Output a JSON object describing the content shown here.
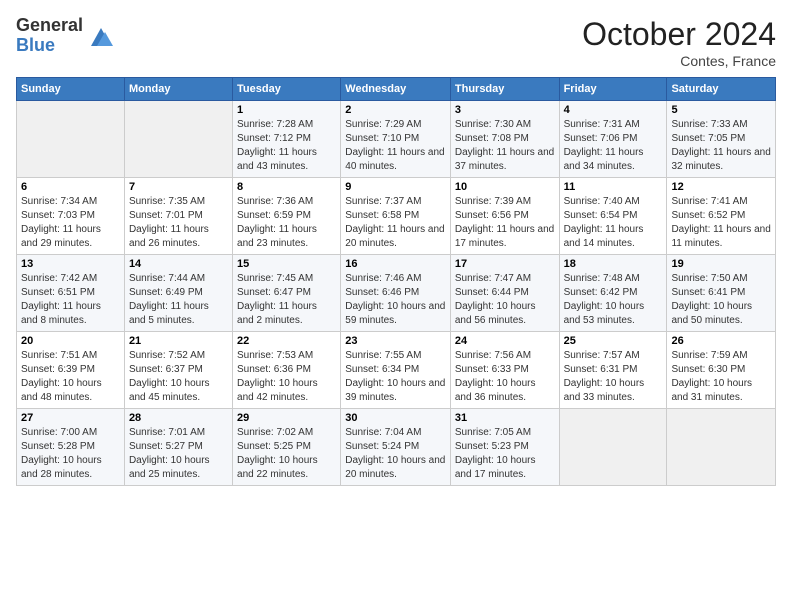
{
  "logo": {
    "general": "General",
    "blue": "Blue"
  },
  "title": "October 2024",
  "location": "Contes, France",
  "days_of_week": [
    "Sunday",
    "Monday",
    "Tuesday",
    "Wednesday",
    "Thursday",
    "Friday",
    "Saturday"
  ],
  "weeks": [
    [
      {
        "day": "",
        "info": ""
      },
      {
        "day": "",
        "info": ""
      },
      {
        "day": "1",
        "info": "Sunrise: 7:28 AM\nSunset: 7:12 PM\nDaylight: 11 hours and 43 minutes."
      },
      {
        "day": "2",
        "info": "Sunrise: 7:29 AM\nSunset: 7:10 PM\nDaylight: 11 hours and 40 minutes."
      },
      {
        "day": "3",
        "info": "Sunrise: 7:30 AM\nSunset: 7:08 PM\nDaylight: 11 hours and 37 minutes."
      },
      {
        "day": "4",
        "info": "Sunrise: 7:31 AM\nSunset: 7:06 PM\nDaylight: 11 hours and 34 minutes."
      },
      {
        "day": "5",
        "info": "Sunrise: 7:33 AM\nSunset: 7:05 PM\nDaylight: 11 hours and 32 minutes."
      }
    ],
    [
      {
        "day": "6",
        "info": "Sunrise: 7:34 AM\nSunset: 7:03 PM\nDaylight: 11 hours and 29 minutes."
      },
      {
        "day": "7",
        "info": "Sunrise: 7:35 AM\nSunset: 7:01 PM\nDaylight: 11 hours and 26 minutes."
      },
      {
        "day": "8",
        "info": "Sunrise: 7:36 AM\nSunset: 6:59 PM\nDaylight: 11 hours and 23 minutes."
      },
      {
        "day": "9",
        "info": "Sunrise: 7:37 AM\nSunset: 6:58 PM\nDaylight: 11 hours and 20 minutes."
      },
      {
        "day": "10",
        "info": "Sunrise: 7:39 AM\nSunset: 6:56 PM\nDaylight: 11 hours and 17 minutes."
      },
      {
        "day": "11",
        "info": "Sunrise: 7:40 AM\nSunset: 6:54 PM\nDaylight: 11 hours and 14 minutes."
      },
      {
        "day": "12",
        "info": "Sunrise: 7:41 AM\nSunset: 6:52 PM\nDaylight: 11 hours and 11 minutes."
      }
    ],
    [
      {
        "day": "13",
        "info": "Sunrise: 7:42 AM\nSunset: 6:51 PM\nDaylight: 11 hours and 8 minutes."
      },
      {
        "day": "14",
        "info": "Sunrise: 7:44 AM\nSunset: 6:49 PM\nDaylight: 11 hours and 5 minutes."
      },
      {
        "day": "15",
        "info": "Sunrise: 7:45 AM\nSunset: 6:47 PM\nDaylight: 11 hours and 2 minutes."
      },
      {
        "day": "16",
        "info": "Sunrise: 7:46 AM\nSunset: 6:46 PM\nDaylight: 10 hours and 59 minutes."
      },
      {
        "day": "17",
        "info": "Sunrise: 7:47 AM\nSunset: 6:44 PM\nDaylight: 10 hours and 56 minutes."
      },
      {
        "day": "18",
        "info": "Sunrise: 7:48 AM\nSunset: 6:42 PM\nDaylight: 10 hours and 53 minutes."
      },
      {
        "day": "19",
        "info": "Sunrise: 7:50 AM\nSunset: 6:41 PM\nDaylight: 10 hours and 50 minutes."
      }
    ],
    [
      {
        "day": "20",
        "info": "Sunrise: 7:51 AM\nSunset: 6:39 PM\nDaylight: 10 hours and 48 minutes."
      },
      {
        "day": "21",
        "info": "Sunrise: 7:52 AM\nSunset: 6:37 PM\nDaylight: 10 hours and 45 minutes."
      },
      {
        "day": "22",
        "info": "Sunrise: 7:53 AM\nSunset: 6:36 PM\nDaylight: 10 hours and 42 minutes."
      },
      {
        "day": "23",
        "info": "Sunrise: 7:55 AM\nSunset: 6:34 PM\nDaylight: 10 hours and 39 minutes."
      },
      {
        "day": "24",
        "info": "Sunrise: 7:56 AM\nSunset: 6:33 PM\nDaylight: 10 hours and 36 minutes."
      },
      {
        "day": "25",
        "info": "Sunrise: 7:57 AM\nSunset: 6:31 PM\nDaylight: 10 hours and 33 minutes."
      },
      {
        "day": "26",
        "info": "Sunrise: 7:59 AM\nSunset: 6:30 PM\nDaylight: 10 hours and 31 minutes."
      }
    ],
    [
      {
        "day": "27",
        "info": "Sunrise: 7:00 AM\nSunset: 5:28 PM\nDaylight: 10 hours and 28 minutes."
      },
      {
        "day": "28",
        "info": "Sunrise: 7:01 AM\nSunset: 5:27 PM\nDaylight: 10 hours and 25 minutes."
      },
      {
        "day": "29",
        "info": "Sunrise: 7:02 AM\nSunset: 5:25 PM\nDaylight: 10 hours and 22 minutes."
      },
      {
        "day": "30",
        "info": "Sunrise: 7:04 AM\nSunset: 5:24 PM\nDaylight: 10 hours and 20 minutes."
      },
      {
        "day": "31",
        "info": "Sunrise: 7:05 AM\nSunset: 5:23 PM\nDaylight: 10 hours and 17 minutes."
      },
      {
        "day": "",
        "info": ""
      },
      {
        "day": "",
        "info": ""
      }
    ]
  ]
}
